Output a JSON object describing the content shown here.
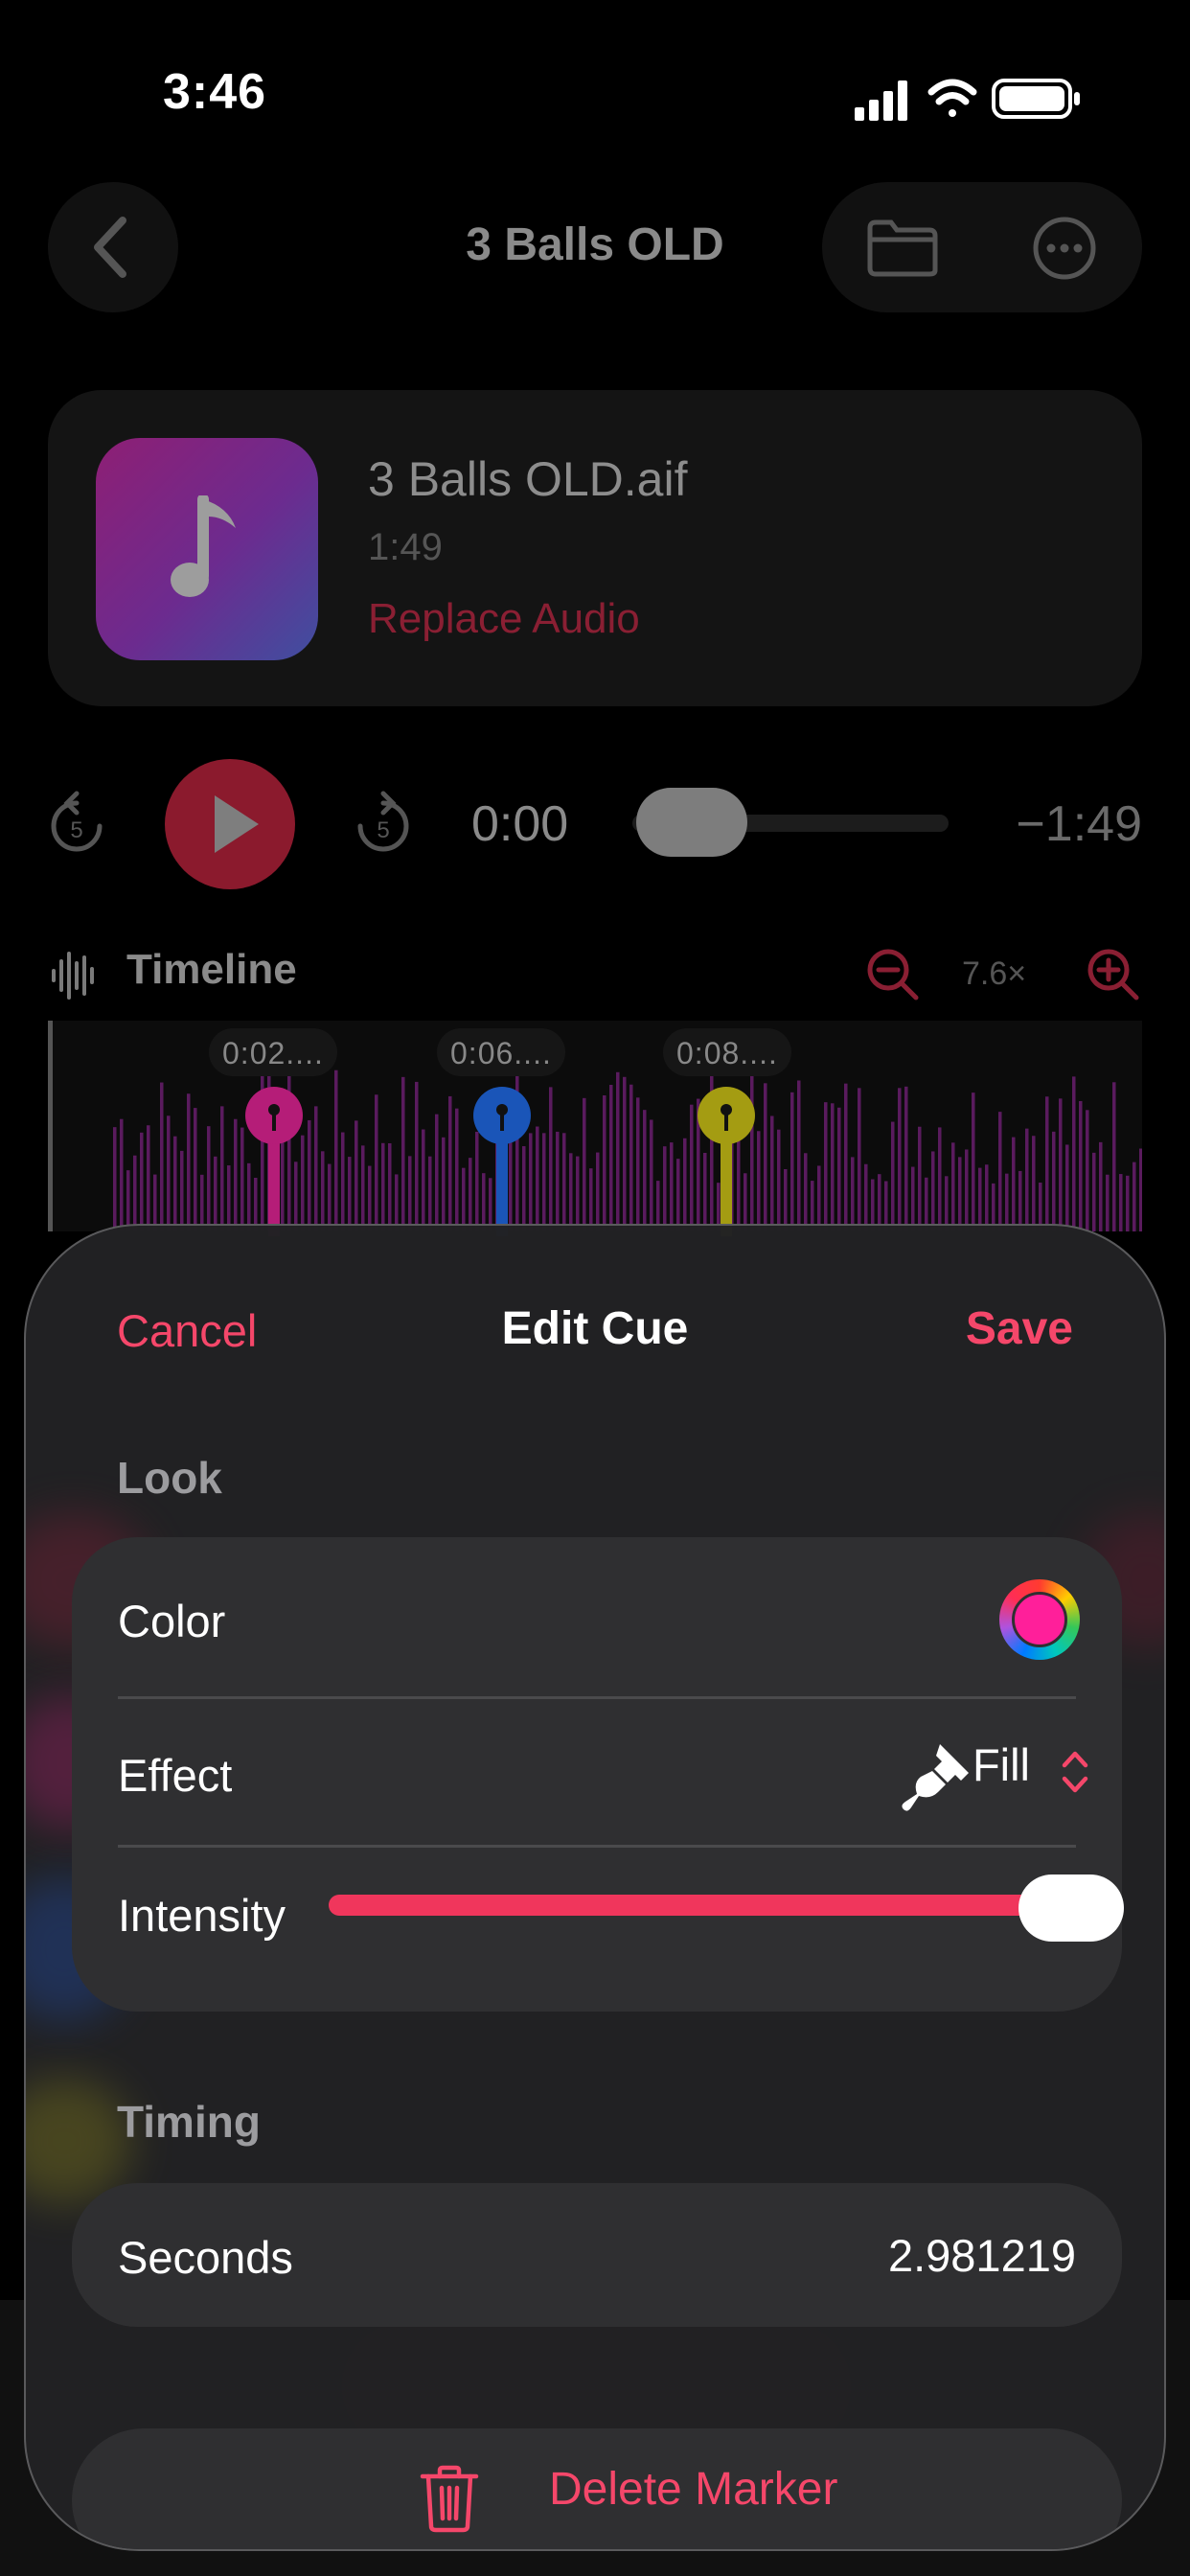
{
  "status_bar": {
    "time": "3:46"
  },
  "nav": {
    "title": "3 Balls OLD"
  },
  "audio": {
    "file_name": "3 Balls OLD.aif",
    "duration": "1:49",
    "replace_label": "Replace Audio"
  },
  "transport": {
    "skip_back_seconds": "5",
    "skip_forward_seconds": "5",
    "current_time": "0:00",
    "remaining_time": "−1:49",
    "progress": 0.0
  },
  "timeline": {
    "label": "Timeline",
    "zoom": "7.6×",
    "markers": [
      {
        "label": "0:02....",
        "color": "#d6288e"
      },
      {
        "label": "0:06....",
        "color": "#1f6be0"
      },
      {
        "label": "0:08....",
        "color": "#c9c21c"
      }
    ]
  },
  "sheet": {
    "cancel_label": "Cancel",
    "title": "Edit Cue",
    "save_label": "Save",
    "look_header": "Look",
    "color_label": "Color",
    "color_value": "#ff1f9a",
    "effect_label": "Effect",
    "effect_value": "Fill",
    "intensity_label": "Intensity",
    "intensity_value": 1.0,
    "timing_header": "Timing",
    "seconds_label": "Seconds",
    "seconds_value": "2.981219",
    "delete_label": "Delete Marker"
  },
  "colors": {
    "accent": "#f5476a",
    "sheet_bg": "#222224",
    "group_bg": "#2f2f31"
  }
}
